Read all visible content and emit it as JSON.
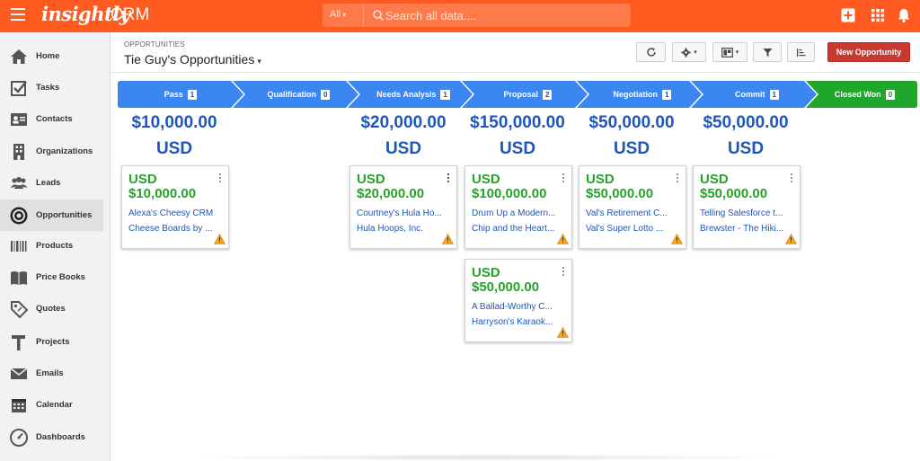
{
  "app": {
    "logo": "insightly",
    "product": "CRM"
  },
  "search": {
    "scope": "All",
    "placeholder": "Search all data...."
  },
  "sidebar": {
    "items": [
      {
        "label": "Home",
        "icon": "home-icon"
      },
      {
        "label": "Tasks",
        "icon": "tasks-icon"
      },
      {
        "label": "Contacts",
        "icon": "contacts-icon"
      },
      {
        "label": "Organizations",
        "icon": "organizations-icon"
      },
      {
        "label": "Leads",
        "icon": "leads-icon"
      },
      {
        "label": "Opportunities",
        "icon": "opportunities-icon",
        "active": true
      },
      {
        "label": "Products",
        "icon": "products-icon"
      },
      {
        "label": "Price Books",
        "icon": "price-books-icon"
      },
      {
        "label": "Quotes",
        "icon": "quotes-icon"
      },
      {
        "label": "Projects",
        "icon": "projects-icon"
      },
      {
        "label": "Emails",
        "icon": "emails-icon"
      },
      {
        "label": "Calendar",
        "icon": "calendar-icon"
      },
      {
        "label": "Dashboards",
        "icon": "dashboards-icon"
      }
    ]
  },
  "header": {
    "section": "OPPORTUNITIES",
    "title": "Tie Guy's Opportunities"
  },
  "toolbar": {
    "new_label": "New Opportunity"
  },
  "stages": [
    {
      "name": "Pass",
      "count": "1",
      "total_amount": "$10,000.00",
      "total_currency": "USD"
    },
    {
      "name": "Qualification",
      "count": "0",
      "total_amount": "",
      "total_currency": ""
    },
    {
      "name": "Needs Analysis",
      "count": "1",
      "total_amount": "$20,000.00",
      "total_currency": "USD"
    },
    {
      "name": "Proposal",
      "count": "2",
      "total_amount": "$150,000.00",
      "total_currency": "USD"
    },
    {
      "name": "Negotiation",
      "count": "1",
      "total_amount": "$50,000.00",
      "total_currency": "USD"
    },
    {
      "name": "Commit",
      "count": "1",
      "total_amount": "$50,000.00",
      "total_currency": "USD"
    },
    {
      "name": "Closed Won",
      "count": "0",
      "total_amount": "",
      "total_currency": ""
    }
  ],
  "cards": [
    {
      "currency": "USD",
      "amount": "$10,000.00",
      "name": "Alexa's Cheesy CRM",
      "org": "Cheese Boards by ..."
    },
    {
      "currency": "USD",
      "amount": "$20,000.00",
      "name": "Courtney's Hula Ho...",
      "org": "Hula Hoops, Inc."
    },
    {
      "currency": "USD",
      "amount": "$100,000.00",
      "name": "Drum Up a Modern...",
      "org": "Chip and the Heart..."
    },
    {
      "currency": "USD",
      "amount": "$50,000.00",
      "name": "A Ballad-Worthy C...",
      "org": "Harryson's Karaok..."
    },
    {
      "currency": "USD",
      "amount": "$50,000.00",
      "name": "Val's Retirement C...",
      "org": "Val's Super Lotto ..."
    },
    {
      "currency": "USD",
      "amount": "$50,000.00",
      "name": "Telling Salesforce t...",
      "org": "Brewster - The Hiki..."
    }
  ],
  "colors": {
    "brand": "#ff5a1f",
    "stage": "#3b86f0",
    "won": "#1fa62b",
    "amount_blue": "#1e57b8",
    "amount_green": "#26a12a"
  }
}
